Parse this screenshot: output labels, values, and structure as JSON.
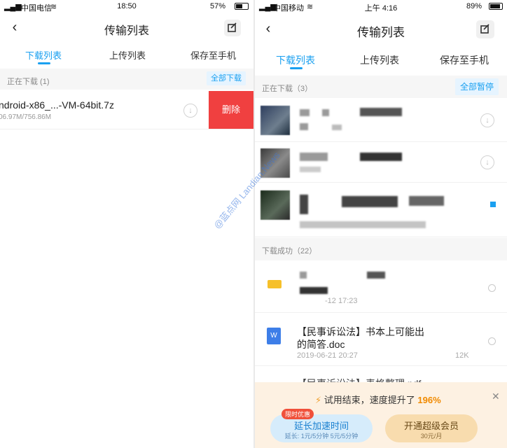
{
  "left": {
    "status": {
      "carrier": "中国电信",
      "time": "18:50",
      "battery": "57%"
    },
    "title": "传输列表",
    "tabs": [
      "下载列表",
      "上传列表",
      "保存至手机"
    ],
    "downloading_section": {
      "label": "正在下载 (1)",
      "action": "全部下载"
    },
    "download_item": {
      "name": "ndroid-x86_...-VM-64bit.7z",
      "progress_text": "06.97M/756.86M"
    },
    "delete_label": "删除"
  },
  "right": {
    "status": {
      "carrier": "中国移动",
      "time": "上午 4:16",
      "battery": "89%"
    },
    "title": "传输列表",
    "tabs": [
      "下载列表",
      "上传列表",
      "保存至手机"
    ],
    "downloading_section": {
      "label": "正在下载（3）",
      "action": "全部暂停"
    },
    "completed_section": {
      "label": "下载成功（22）"
    },
    "completed_items": [
      {
        "name_visible": "",
        "meta_visible": "-12 17:23",
        "size": ""
      },
      {
        "name_line1": "【民事诉讼法】书本上可能出",
        "name_line2": "的简答.doc",
        "date": "2019-06-21 20:27",
        "size": "12K"
      },
      {
        "name_line1": "【民事诉讼法】表格整理.pdf"
      }
    ],
    "promo": {
      "text_prefix": "试用结束，速度提升了",
      "percent": "196%",
      "badge": "限时优惠",
      "extend_title": "延长加速时间",
      "extend_price": "延长: 1元/5分钟 5元/5分钟",
      "vip_title": "开通超级会员",
      "vip_price": "30元/月",
      "watermark": "@蓝点网 Landian.News"
    },
    "colors": {
      "accent": "#1aa0f0",
      "delete": "#f04040",
      "percent": "#f08a00",
      "promo_bg": "#fdf1e2"
    }
  }
}
